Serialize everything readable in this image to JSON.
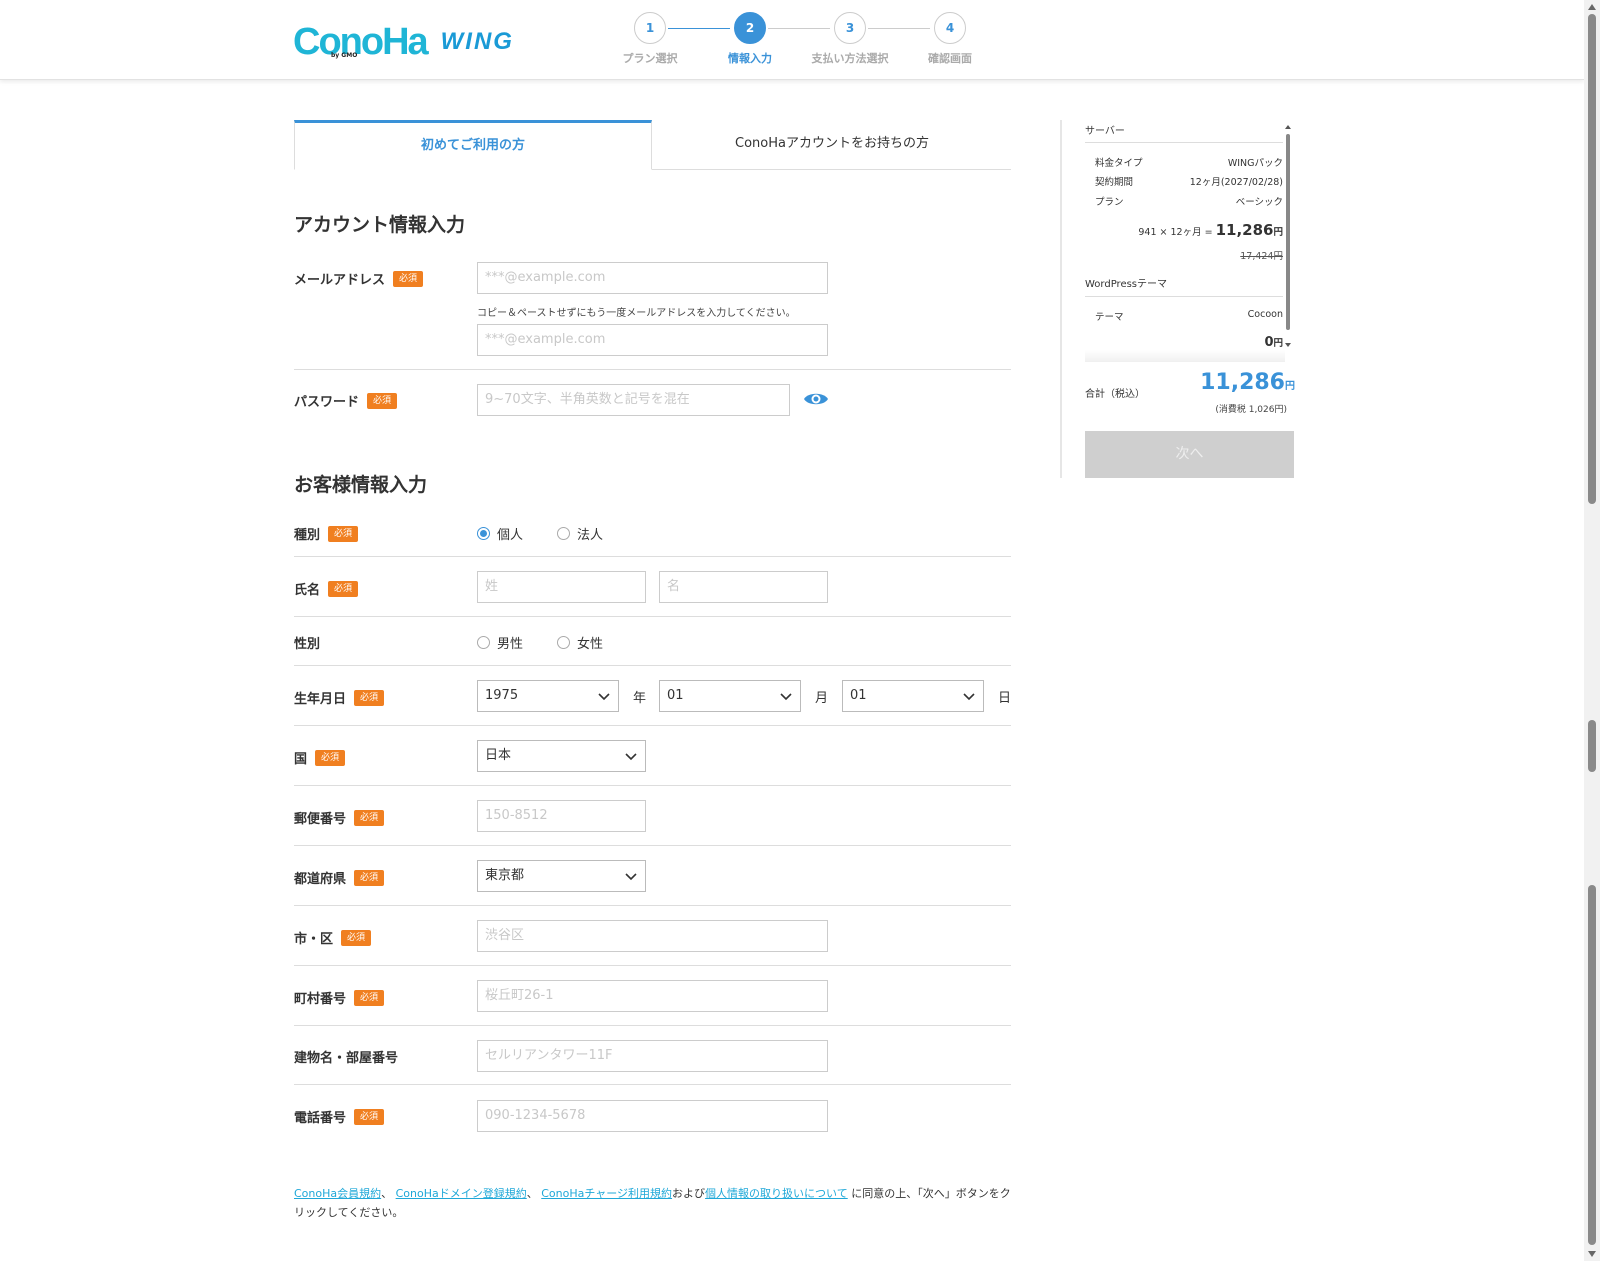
{
  "brand": {
    "logo_main": "ConoHa",
    "logo_sub": "by GMO",
    "logo_product": "WING"
  },
  "steps": [
    {
      "number": "1",
      "label": "プラン選択",
      "state": "done"
    },
    {
      "number": "2",
      "label": "情報入力",
      "state": "active"
    },
    {
      "number": "3",
      "label": "支払い方法選択",
      "state": "pending"
    },
    {
      "number": "4",
      "label": "確認画面",
      "state": "pending"
    }
  ],
  "tabs": {
    "new_user": "初めてご利用の方",
    "existing_user": "ConoHaアカウントをお持ちの方"
  },
  "required_badge": "必須",
  "account": {
    "title": "アカウント情報入力",
    "email_label": "メールアドレス",
    "email_placeholder": "***@example.com",
    "email_confirm_hint": "コピー＆ペーストせずにもう一度メールアドレスを入力してください。",
    "email_confirm_placeholder": "***@example.com",
    "password_label": "パスワード",
    "password_placeholder": "9~70文字、半角英数と記号を混在"
  },
  "customer": {
    "title": "お客様情報入力",
    "type_label": "種別",
    "type_options": [
      "個人",
      "法人"
    ],
    "type_selected": "個人",
    "name_label": "氏名",
    "last_name_placeholder": "姓",
    "first_name_placeholder": "名",
    "gender_label": "性別",
    "gender_options": [
      "男性",
      "女性"
    ],
    "birth_label": "生年月日",
    "birth_year": "1975",
    "birth_year_unit": "年",
    "birth_month": "01",
    "birth_month_unit": "月",
    "birth_day": "01",
    "birth_day_unit": "日",
    "country_label": "国",
    "country_value": "日本",
    "postal_label": "郵便番号",
    "postal_placeholder": "150-8512",
    "prefecture_label": "都道府県",
    "prefecture_value": "東京都",
    "city_label": "市・区",
    "city_placeholder": "渋谷区",
    "town_label": "町村番号",
    "town_placeholder": "桜丘町26-1",
    "building_label": "建物名・部屋番号",
    "building_placeholder": "セルリアンタワー11F",
    "phone_label": "電話番号",
    "phone_placeholder": "090-1234-5678"
  },
  "terms": {
    "link1": "ConoHa会員規約",
    "sep1": "、",
    "link2": "ConoHaドメイン登録規約",
    "sep2": "、",
    "link3": "ConoHaチャージ利用規約",
    "and": "および",
    "link4": "個人情報の取り扱いについて",
    "tail": "に同意の上、「次へ」ボタンをクリックしてください。"
  },
  "summary": {
    "server_heading": "サーバー",
    "rows": [
      {
        "label": "料金タイプ",
        "value": "WINGパック"
      },
      {
        "label": "契約期間",
        "value": "12ヶ月(2027/02/28)"
      },
      {
        "label": "プラン",
        "value": "ベーシック"
      }
    ],
    "calc_prefix": "941 × 12ヶ月 =",
    "calc_total": "11,286",
    "yen": "円",
    "strike_price": "17,424円",
    "theme_heading": "WordPressテーマ",
    "theme_row": {
      "label": "テーマ",
      "value": "Cocoon"
    },
    "theme_price": "0",
    "total_label": "合計（税込）",
    "total_value": "11,286",
    "tax_note": "(消費税 1,026円)",
    "next_button": "次へ"
  },
  "colors": {
    "accent": "#3a92d8",
    "required": "#f07f20",
    "logo": "#1fb5d6",
    "disabled_button": "#cfcfcf"
  }
}
